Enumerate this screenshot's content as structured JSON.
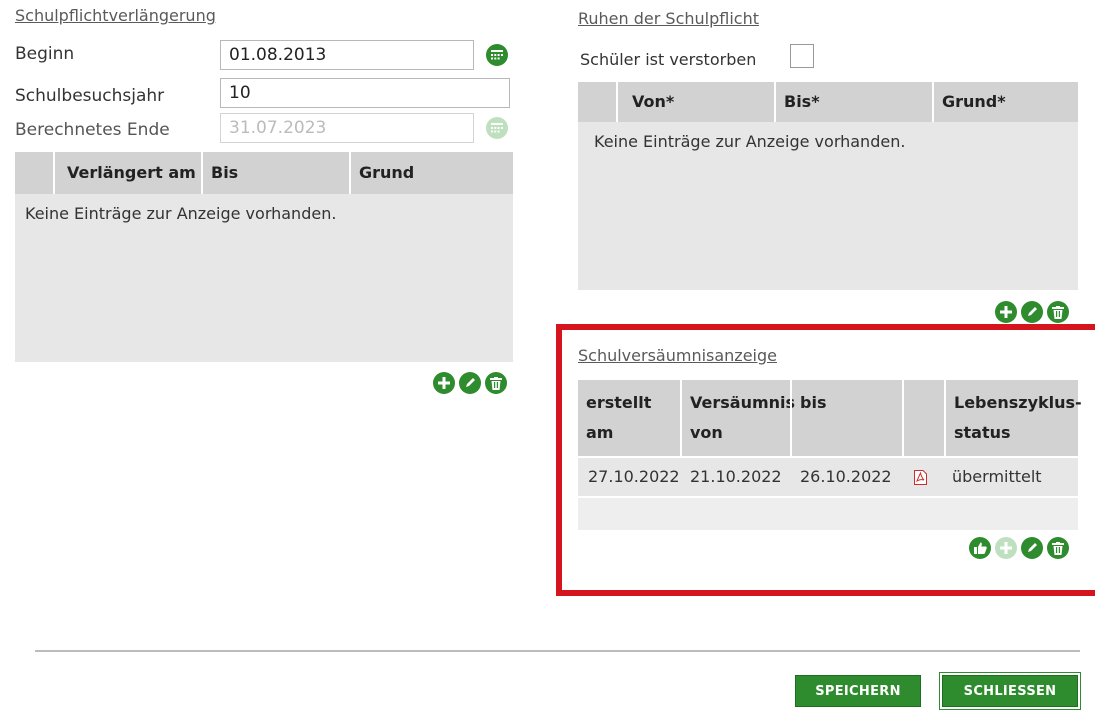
{
  "extension": {
    "title": "Schulpflichtverlängerung",
    "start_label": "Beginn",
    "start_value": "01.08.2013",
    "school_year_label": "Schulbesuchsjahr",
    "school_year_value": "10",
    "calc_end_label": "Berechnetes Ende",
    "calc_end_value": "31.07.2023",
    "grid": {
      "columns": [
        "Verlängert am",
        "Bis",
        "Grund"
      ],
      "empty": "Keine Einträge zur Anzeige vorhanden."
    }
  },
  "suspension": {
    "title": "Ruhen der Schulpflicht",
    "deceased_label": "Schüler ist verstorben",
    "deceased_checked": false,
    "grid": {
      "columns": [
        "Von*",
        "Bis*",
        "Grund*"
      ],
      "empty": "Keine Einträge zur Anzeige vorhanden."
    }
  },
  "absence_report": {
    "title": "Schulversäumnisanzeige",
    "columns": [
      "erstellt am",
      "Versäumnis von",
      "bis",
      "",
      "Lebenszyklus-status"
    ],
    "rows": [
      {
        "created": "27.10.2022",
        "from": "21.10.2022",
        "to": "26.10.2022",
        "doc": "pdf-icon",
        "status": "übermittelt"
      }
    ]
  },
  "icons": {
    "add": "plus-icon",
    "edit": "pencil-icon",
    "delete": "trash-icon",
    "approve": "thumbs-up-icon",
    "calendar": "calendar-icon"
  },
  "footer": {
    "save_label": "SPEICHERN",
    "close_label": "SCHLIESSEN"
  },
  "colors": {
    "accent_green": "#2e8b2e",
    "highlight_red": "#d6141e",
    "grid_bg": "#e7e7e7",
    "grid_header": "#d2d2d2"
  }
}
